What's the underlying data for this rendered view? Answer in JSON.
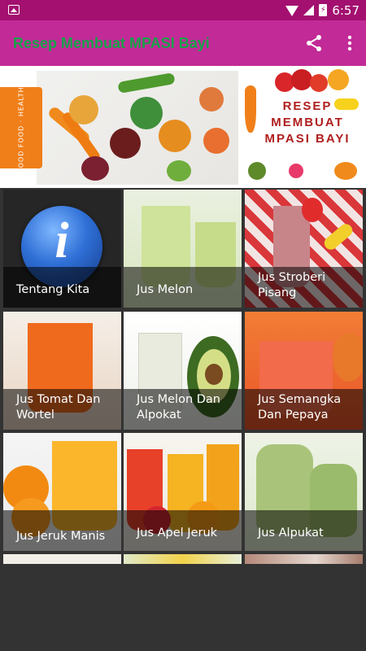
{
  "status_bar": {
    "time": "6:57",
    "battery_glyph": "⚡"
  },
  "app_bar": {
    "title": "Resep Membuat MPASI Bayi",
    "share_icon": "share-icon",
    "more_icon": "more-vert-icon"
  },
  "banner": {
    "side_tag": "GOOD FOOD · HEALTHY",
    "promo_line1": "RESEP",
    "promo_line2": "MEMBUAT",
    "promo_line3": "MPASI BAYI"
  },
  "colors": {
    "status_bar": "#a3106f",
    "app_bar": "#c22a97",
    "title": "#16a34a",
    "background": "#333333"
  },
  "grid": [
    {
      "label": "Tentang Kita"
    },
    {
      "label": "Jus Melon"
    },
    {
      "label": "Jus Stroberi Pisang"
    },
    {
      "label": "Jus Tomat Dan Wortel"
    },
    {
      "label": "Jus Melon Dan Alpokat"
    },
    {
      "label": "Jus Semangka Dan Pepaya"
    },
    {
      "label": "Jus Jeruk Manis"
    },
    {
      "label": "Jus Apel Jeruk"
    },
    {
      "label": "Jus Alpukat"
    }
  ]
}
